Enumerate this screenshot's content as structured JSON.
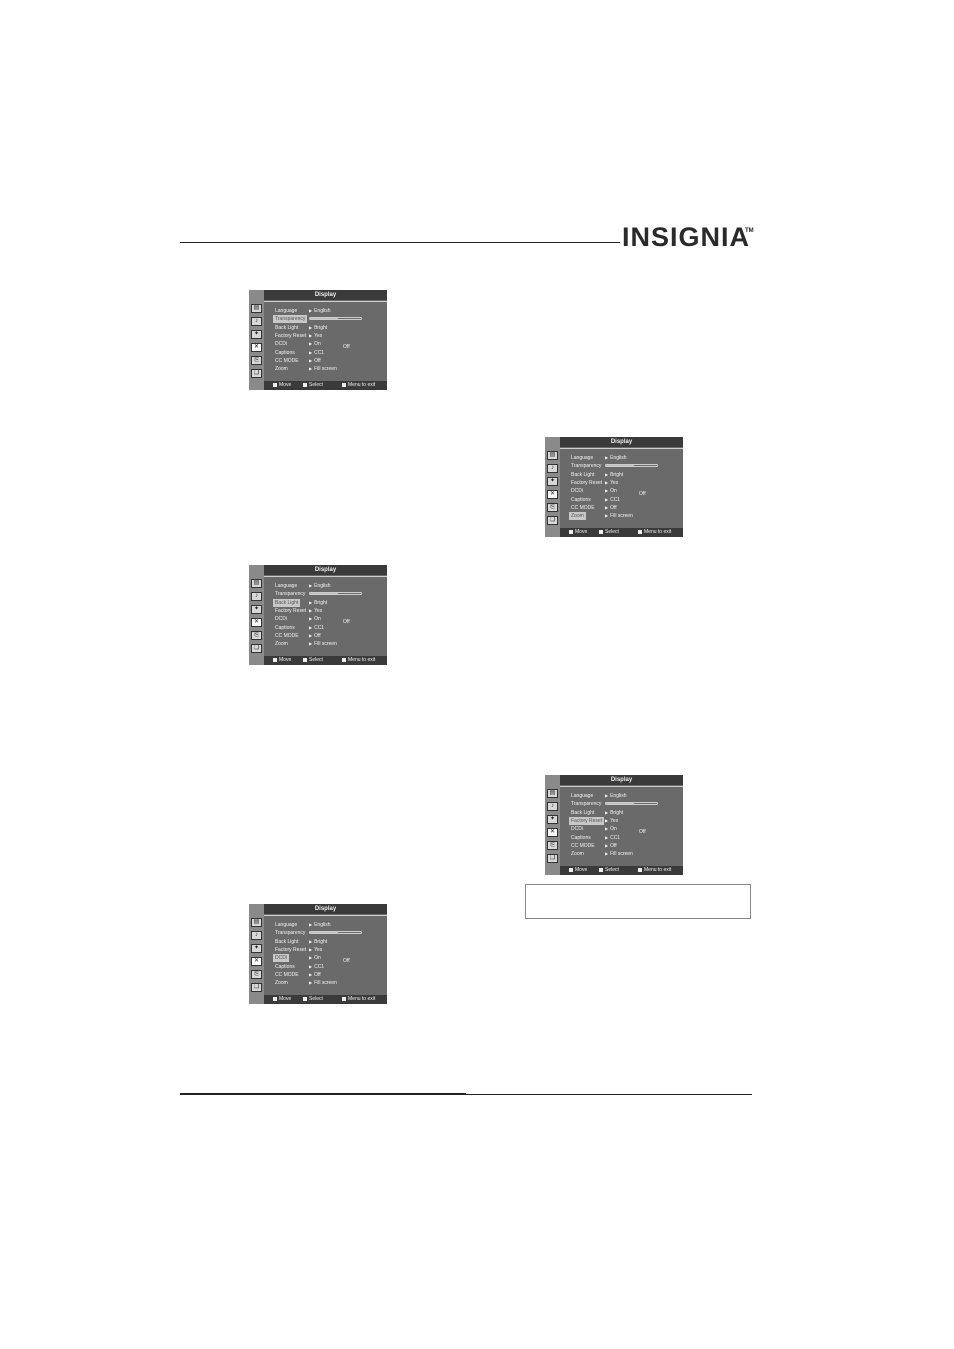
{
  "brand": {
    "logo_text": "INSIGNIA",
    "trademark": "TM"
  },
  "menus": [
    {
      "title": "Display",
      "selected": "Transparency",
      "rows": [
        {
          "label": "Language",
          "value": "English"
        },
        {
          "label": "Transparency",
          "slider": 0.55
        },
        {
          "label": "Back Light",
          "value": "Bright"
        },
        {
          "label": "Factory Reset",
          "value": "Yes"
        },
        {
          "label": "DCDi",
          "value": "On"
        },
        {
          "label": "Captions",
          "value": "CC1"
        },
        {
          "label": "CC MODE",
          "value": "Off"
        },
        {
          "label": "Zoom",
          "value": "Fill screen"
        }
      ],
      "extra": "Off",
      "footer": {
        "move": "Move",
        "select": "Select",
        "exit": "Menu to exit"
      }
    },
    {
      "title": "Display",
      "selected": "Back Light",
      "rows": [
        {
          "label": "Language",
          "value": "English"
        },
        {
          "label": "Transparency",
          "slider": 0.55
        },
        {
          "label": "Back Light",
          "value": "Bright"
        },
        {
          "label": "Factory Reset",
          "value": "Yes"
        },
        {
          "label": "DCDi",
          "value": "On"
        },
        {
          "label": "Captions",
          "value": "CC1"
        },
        {
          "label": "CC MODE",
          "value": "Off"
        },
        {
          "label": "Zoom",
          "value": "Fill screen"
        }
      ],
      "extra": "Off",
      "footer": {
        "move": "Move",
        "select": "Select",
        "exit": "Menu to exit"
      }
    },
    {
      "title": "Display",
      "selected": "DCDi",
      "rows": [
        {
          "label": "Language",
          "value": "English"
        },
        {
          "label": "Transparency",
          "slider": 0.55
        },
        {
          "label": "Back Light",
          "value": "Bright"
        },
        {
          "label": "Factory Reset",
          "value": "Yes"
        },
        {
          "label": "DCDi",
          "value": "On"
        },
        {
          "label": "Captions",
          "value": "CC1"
        },
        {
          "label": "CC MODE",
          "value": "Off"
        },
        {
          "label": "Zoom",
          "value": "Fill screen"
        }
      ],
      "extra": "Off",
      "footer": {
        "move": "Move",
        "select": "Select",
        "exit": "Menu to exit"
      }
    },
    {
      "title": "Display",
      "selected": "Zoom",
      "rows": [
        {
          "label": "Language",
          "value": "English"
        },
        {
          "label": "Transparency",
          "slider": 0.55
        },
        {
          "label": "Back Light",
          "value": "Bright"
        },
        {
          "label": "Factory Reset",
          "value": "Yes"
        },
        {
          "label": "DCDi",
          "value": "On"
        },
        {
          "label": "Captions",
          "value": "CC1"
        },
        {
          "label": "CC MODE",
          "value": "Off"
        },
        {
          "label": "Zoom",
          "value": "Fill screen"
        }
      ],
      "extra": "Off",
      "footer": {
        "move": "Move",
        "select": "Select",
        "exit": "Menu to exit"
      }
    },
    {
      "title": "Display",
      "selected": "Factory Reset",
      "rows": [
        {
          "label": "Language",
          "value": "English"
        },
        {
          "label": "Transparency",
          "slider": 0.55
        },
        {
          "label": "Back Light",
          "value": "Bright"
        },
        {
          "label": "Factory Reset",
          "value": "Yes"
        },
        {
          "label": "DCDi",
          "value": "On"
        },
        {
          "label": "Captions",
          "value": "CC1"
        },
        {
          "label": "CC MODE",
          "value": "Off"
        },
        {
          "label": "Zoom",
          "value": "Fill screen"
        }
      ],
      "extra": "Off",
      "footer": {
        "move": "Move",
        "select": "Select",
        "exit": "Menu to exit"
      }
    }
  ]
}
